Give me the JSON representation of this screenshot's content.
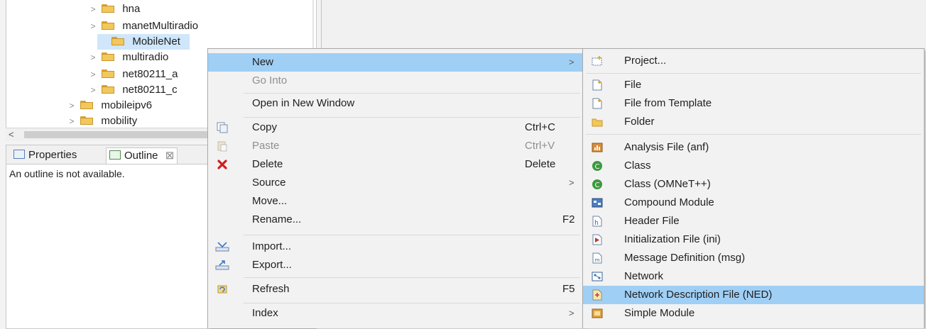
{
  "explorer": {
    "items": [
      {
        "label": "hna",
        "expandable": true,
        "selected": false
      },
      {
        "label": "manetMultiradio",
        "expandable": true,
        "selected": false
      },
      {
        "label": "MobileNet",
        "expandable": false,
        "selected": true
      },
      {
        "label": "multiradio",
        "expandable": true,
        "selected": false
      },
      {
        "label": "net80211_a",
        "expandable": true,
        "selected": false
      },
      {
        "label": "net80211_c",
        "expandable": true,
        "selected": false
      },
      {
        "label": "mobileipv6",
        "expandable": true,
        "selected": false
      },
      {
        "label": "mobility",
        "expandable": true,
        "selected": false
      }
    ],
    "scroll_left": "<"
  },
  "panel": {
    "tabs": [
      {
        "label": "Properties",
        "active": false
      },
      {
        "label": "Outline",
        "active": true,
        "close": "⊠"
      }
    ],
    "message": "An outline is not available."
  },
  "context_menu": {
    "items": [
      {
        "label": "New",
        "accel": "",
        "submenu": true,
        "highlighted": true,
        "disabled": false,
        "icon": ""
      },
      {
        "label": "Go Into",
        "accel": "",
        "submenu": false,
        "highlighted": false,
        "disabled": true,
        "icon": ""
      },
      {
        "label": "Open in New Window",
        "accel": "",
        "submenu": false,
        "highlighted": false,
        "disabled": false,
        "icon": ""
      },
      {
        "label": "Copy",
        "accel": "Ctrl+C",
        "submenu": false,
        "highlighted": false,
        "disabled": false,
        "icon": "copy-icon"
      },
      {
        "label": "Paste",
        "accel": "Ctrl+V",
        "submenu": false,
        "highlighted": false,
        "disabled": true,
        "icon": "paste-icon"
      },
      {
        "label": "Delete",
        "accel": "Delete",
        "submenu": false,
        "highlighted": false,
        "disabled": false,
        "icon": "delete-icon"
      },
      {
        "label": "Source",
        "accel": "",
        "submenu": true,
        "highlighted": false,
        "disabled": false,
        "icon": ""
      },
      {
        "label": "Move...",
        "accel": "",
        "submenu": false,
        "highlighted": false,
        "disabled": false,
        "icon": ""
      },
      {
        "label": "Rename...",
        "accel": "F2",
        "submenu": false,
        "highlighted": false,
        "disabled": false,
        "icon": ""
      },
      {
        "label": "Import...",
        "accel": "",
        "submenu": false,
        "highlighted": false,
        "disabled": false,
        "icon": "import-icon"
      },
      {
        "label": "Export...",
        "accel": "",
        "submenu": false,
        "highlighted": false,
        "disabled": false,
        "icon": "export-icon"
      },
      {
        "label": "Refresh",
        "accel": "F5",
        "submenu": false,
        "highlighted": false,
        "disabled": false,
        "icon": "refresh-icon"
      },
      {
        "label": "Index",
        "accel": "",
        "submenu": true,
        "highlighted": false,
        "disabled": false,
        "icon": ""
      }
    ]
  },
  "new_submenu": {
    "items": [
      {
        "label": "Project...",
        "icon": "project-icon",
        "highlighted": false
      },
      {
        "label": "File",
        "icon": "file-icon",
        "highlighted": false
      },
      {
        "label": "File from Template",
        "icon": "file-template-icon",
        "highlighted": false
      },
      {
        "label": "Folder",
        "icon": "folder-icon",
        "highlighted": false
      },
      {
        "label": "Analysis File (anf)",
        "icon": "analysis-file-icon",
        "highlighted": false
      },
      {
        "label": "Class",
        "icon": "class-icon",
        "highlighted": false
      },
      {
        "label": "Class (OMNeT++)",
        "icon": "class-omnet-icon",
        "highlighted": false
      },
      {
        "label": "Compound Module",
        "icon": "compound-module-icon",
        "highlighted": false
      },
      {
        "label": "Header File",
        "icon": "header-file-icon",
        "highlighted": false
      },
      {
        "label": "Initialization File (ini)",
        "icon": "ini-file-icon",
        "highlighted": false
      },
      {
        "label": "Message Definition (msg)",
        "icon": "msg-file-icon",
        "highlighted": false
      },
      {
        "label": "Network",
        "icon": "network-icon",
        "highlighted": false
      },
      {
        "label": "Network Description File (NED)",
        "icon": "ned-file-icon",
        "highlighted": true
      },
      {
        "label": "Simple Module",
        "icon": "simple-module-icon",
        "highlighted": false
      }
    ]
  },
  "colors": {
    "highlight": "#9fcff5",
    "menu_bg": "#f2f2f2",
    "folder": "#f2c75c"
  }
}
